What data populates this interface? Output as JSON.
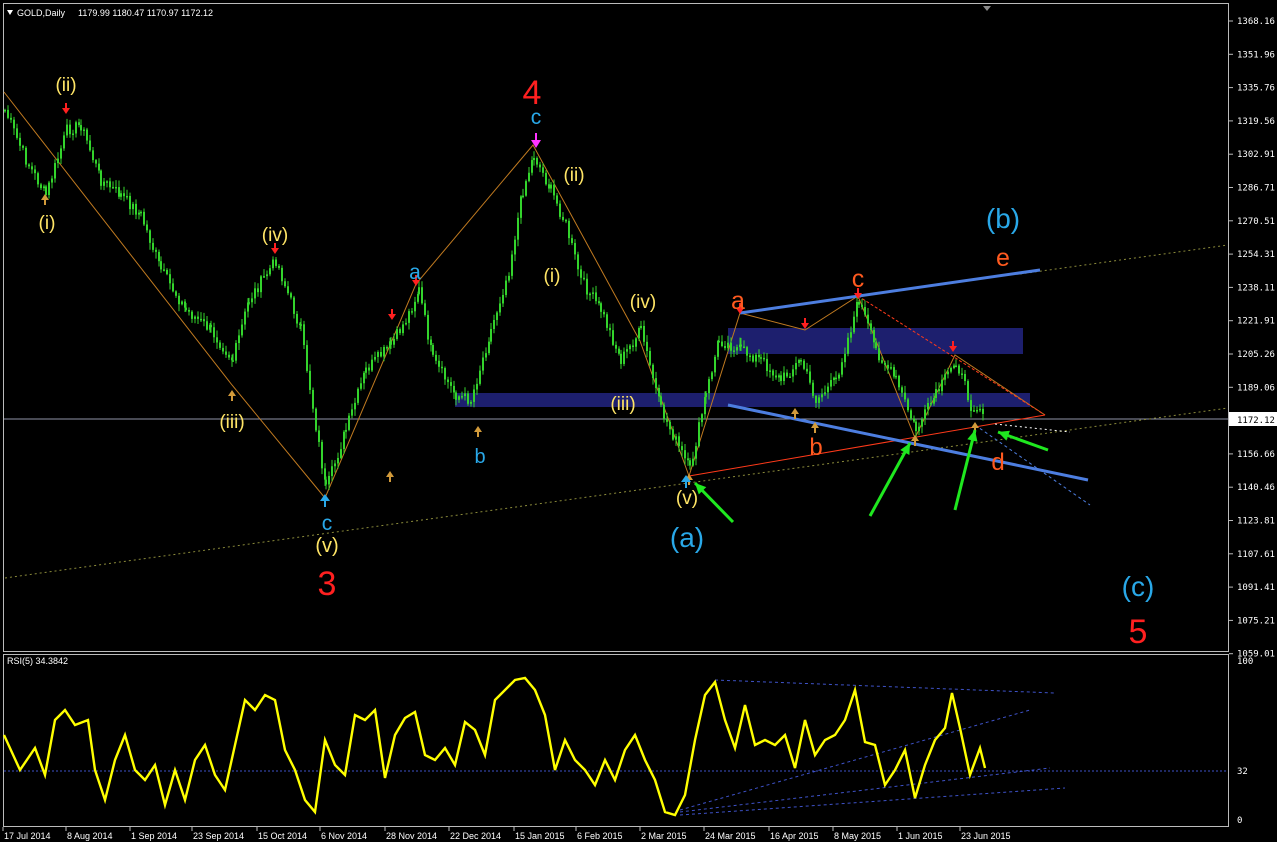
{
  "header": {
    "menu_arrow": "triangle-down-icon",
    "symbol": "GOLD,Daily",
    "ohlc": "1179.99 1180.47 1170.97 1172.12"
  },
  "price_axis": {
    "labels": [
      "1368.16",
      "1351.96",
      "1335.76",
      "1319.56",
      "1302.91",
      "1286.71",
      "1270.51",
      "1254.31",
      "1238.11",
      "1221.91",
      "1205.26",
      "1189.06",
      "1172.12",
      "1156.66",
      "1140.46",
      "1123.81",
      "1107.61",
      "1091.41",
      "1075.21",
      "1059.01"
    ],
    "current_price": "1172.12"
  },
  "rsi": {
    "title": "RSI(5) 34.3842",
    "axis_labels": [
      "100",
      "32",
      "0"
    ]
  },
  "time_axis": {
    "labels": [
      "17 Jul 2014",
      "8 Aug 2014",
      "1 Sep 2014",
      "23 Sep 2014",
      "15 Oct 2014",
      "6 Nov 2014",
      "28 Nov 2014",
      "22 Dec 2014",
      "15 Jan 2015",
      "6 Feb 2015",
      "2 Mar 2015",
      "24 Mar 2015",
      "16 Apr 2015",
      "8 May 2015",
      "1 Jun 2015",
      "23 Jun 2015"
    ]
  },
  "wave_labels": {
    "w_ii_1": "(ii)",
    "w_i_1": "(i)",
    "w_iv_1": "(iv)",
    "w_iii_1": "(iii)",
    "w_c_1": "c",
    "w_v_1": "(v)",
    "w_3": "3",
    "w_a_1": "a",
    "w_b_1": "b",
    "w_4": "4",
    "w_c_2": "c",
    "w_ii_2": "(ii)",
    "w_i_2": "(i)",
    "w_iv_2": "(iv)",
    "w_iii_2": "(iii)",
    "w_v_2": "(v)",
    "w_a_paren": "(a)",
    "w_a_2": "a",
    "w_b_2": "b",
    "w_c_3": "c",
    "w_d": "d",
    "w_e": "e",
    "w_b_paren": "(b)",
    "w_c_paren": "(c)",
    "w_5": "5"
  },
  "colors": {
    "candle": "#33d42c",
    "rsi_line": "#ffff00",
    "zone": "#1d1f6e",
    "trendline_blue": "#4d7ee0",
    "wave_yellow": "#ffe566",
    "wave_red": "#ff2020",
    "wave_orange": "#ff5a1f",
    "wave_cyan": "#29a8e8",
    "arrow_green": "#1fe81f"
  },
  "chart_data": {
    "type": "candlestick",
    "price_range": [
      1059.01,
      1368.16
    ],
    "rsi_range": [
      0,
      100
    ],
    "rsi_level": 32
  }
}
